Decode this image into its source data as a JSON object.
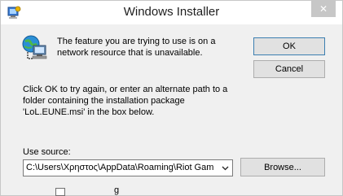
{
  "window": {
    "title": "Windows Installer",
    "close_glyph": "✕"
  },
  "dialog": {
    "message": "The feature you are trying to use is on a network resource that is unavailable.",
    "instructions": "Click OK to try again, or enter an alternate path to a folder containing the installation package 'LoL.EUNE.msi' in the box below.",
    "ok_label": "OK",
    "cancel_label": "Cancel",
    "use_source_label": "Use source:",
    "source_path": "C:\\Users\\Χρηστος\\AppData\\Roaming\\Riot Gam",
    "browse_label": "Browse..."
  },
  "background": {
    "partial_text": "g"
  },
  "icons": {
    "app": "installer-icon",
    "message": "network-computer-icon",
    "dropdown": "chevron-down-icon"
  },
  "colors": {
    "dialog_bg": "#f0f0f0",
    "button_bg": "#e1e1e1",
    "button_border": "#adadad",
    "default_button_border": "#3c7fb1",
    "close_button_bg": "#c7c7c7"
  }
}
